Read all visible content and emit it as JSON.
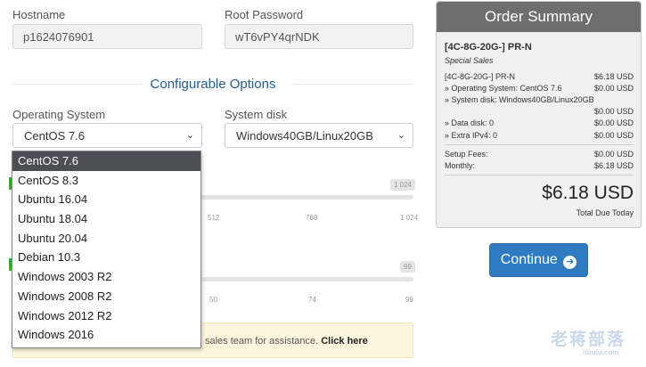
{
  "form": {
    "hostname_label": "Hostname",
    "hostname_value": "p1624076901",
    "root_password_label": "Root Password",
    "root_password_value": "wT6vPY4qrNDK",
    "section_title": "Configurable Options",
    "os_label": "Operating System",
    "os_selected": "CentOS 7.6",
    "disk_label": "System disk",
    "disk_selected": "Windows40GB/Linux20GB",
    "os_options": [
      "CentOS 7.6",
      "CentOS 8.3",
      "Ubuntu 16.04",
      "Ubuntu 18.04",
      "Ubuntu 20.04",
      "Debian 10.3",
      "Windows 2003 R2",
      "Windows 2008 R2",
      "Windows 2012 R2",
      "Windows 2016"
    ],
    "slider1": {
      "badge": "1 024",
      "ticks": [
        "512",
        "768",
        "1 024"
      ]
    },
    "slider2": {
      "badge": "99",
      "ticks": [
        "50",
        "74",
        "99"
      ]
    },
    "notice_text": "sales team for assistance.",
    "notice_link": "Click here"
  },
  "summary": {
    "title": "Order Summary",
    "product": "[4C-8G-20G-] PR-N",
    "group": "Special Sales",
    "lines": [
      {
        "label": "[4C-8G-20G-] PR-N",
        "value": "$6.18 USD"
      },
      {
        "label": "» Operating System: CentOS 7.6",
        "value": "$0.00 USD"
      },
      {
        "label": "» System disk: Windows40GB/Linux20GB",
        "value": ""
      },
      {
        "label": "",
        "value": "$0.00 USD"
      },
      {
        "label": "» Data disk: 0",
        "value": "$0.00 USD"
      },
      {
        "label": "» Extra IPv4: 0",
        "value": "$0.00 USD"
      }
    ],
    "setup_label": "Setup Fees:",
    "setup_value": "$0.00 USD",
    "monthly_label": "Monthly:",
    "monthly_value": "$6.18 USD",
    "total": "$6.18 USD",
    "total_label": "Total Due Today"
  },
  "continue_label": "Continue",
  "continue_icon": "arrow-circle-right-icon",
  "watermark": {
    "main": "老蒋部落",
    "sub": "itbulu.com"
  },
  "colors": {
    "accent": "#2e7bc1",
    "header": "#6e6e6e",
    "slider_handle": "#3aaa35"
  }
}
